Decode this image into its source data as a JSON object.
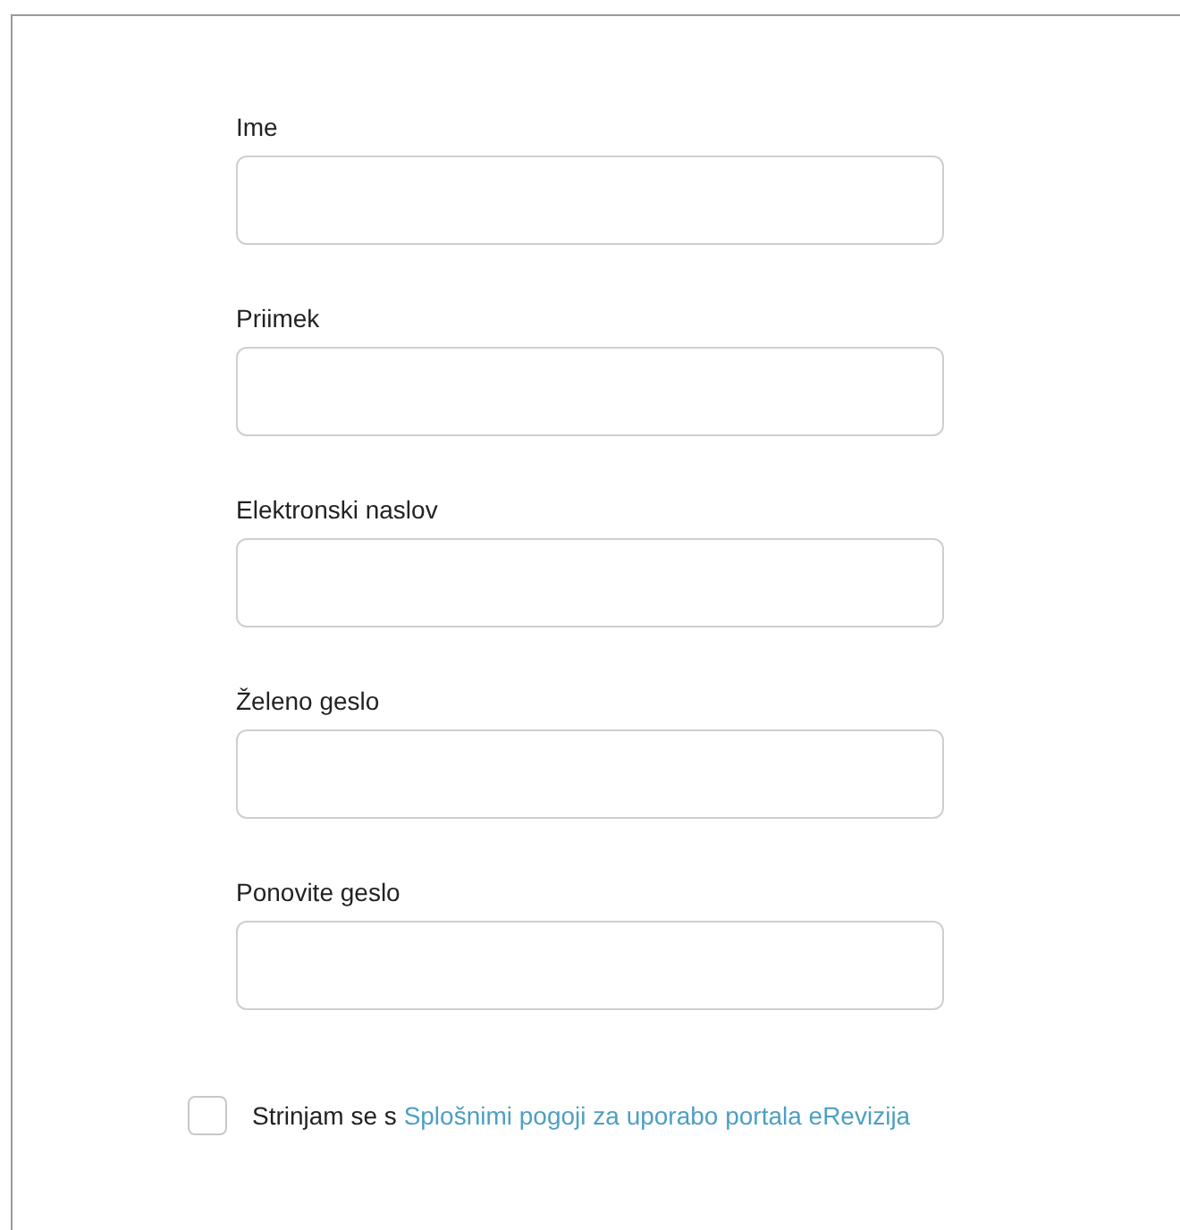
{
  "fields": [
    {
      "label": "Ime"
    },
    {
      "label": "Priimek"
    },
    {
      "label": "Elektronski naslov"
    },
    {
      "label": "Želeno geslo"
    },
    {
      "label": "Ponovite geslo"
    }
  ],
  "agreement": {
    "checked": false,
    "text": "Strinjam se s",
    "link": "Splošnimi pogoji za uporabo portala eRevizija"
  }
}
